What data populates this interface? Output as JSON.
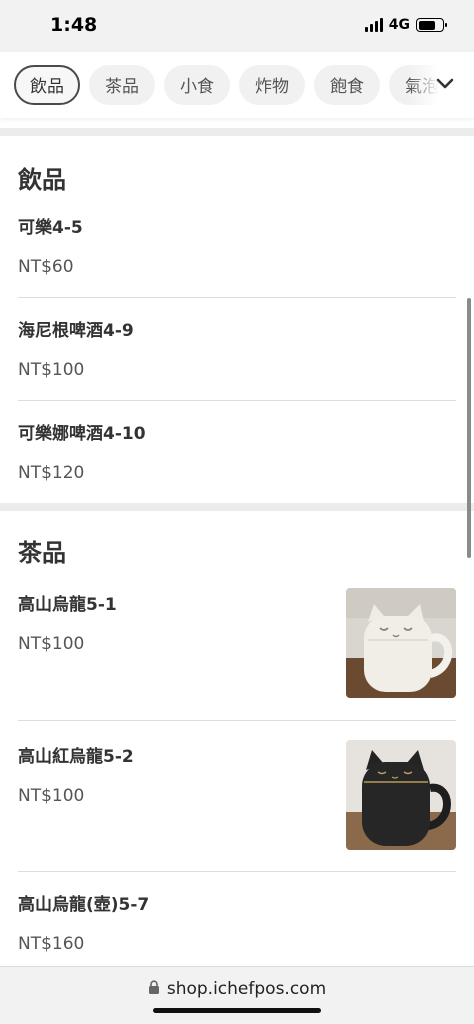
{
  "status": {
    "time": "1:48",
    "network": "4G",
    "battery_level": 0.7
  },
  "tabs": [
    {
      "label": "飲品",
      "active": true
    },
    {
      "label": "茶品",
      "active": false
    },
    {
      "label": "小食",
      "active": false
    },
    {
      "label": "炸物",
      "active": false
    },
    {
      "label": "飽食",
      "active": false
    },
    {
      "label": "氣泡飲",
      "active": false
    }
  ],
  "sections": [
    {
      "title": "飲品",
      "items": [
        {
          "name": "可樂4-5",
          "price": "NT$60"
        },
        {
          "name": "海尼根啤酒4-9",
          "price": "NT$100"
        },
        {
          "name": "可樂娜啤酒4-10",
          "price": "NT$120"
        }
      ]
    },
    {
      "title": "茶品",
      "items": [
        {
          "name": "高山烏龍5-1",
          "price": "NT$100",
          "image": "white-cat-mug"
        },
        {
          "name": "高山紅烏龍5-2",
          "price": "NT$100",
          "image": "black-cat-mug"
        },
        {
          "name": "高山烏龍(壺)5-7",
          "price": "NT$160"
        }
      ]
    }
  ],
  "browser": {
    "url": "shop.ichefpos.com",
    "lock_icon": "lock-icon"
  }
}
